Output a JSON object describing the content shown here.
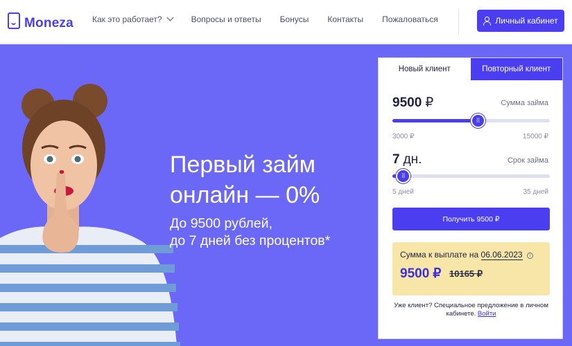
{
  "header": {
    "logo_text": "Moneza",
    "nav": [
      {
        "label": "Как это работает?"
      },
      {
        "label": "Вопросы и ответы"
      },
      {
        "label": "Бонусы"
      },
      {
        "label": "Контакты"
      },
      {
        "label": "Пожаловаться"
      }
    ],
    "cabinet_label": "Личный кабинет"
  },
  "hero": {
    "title_line1": "Первый займ",
    "title_line2": "онлайн — 0%",
    "subtitle_line1": "До 9500 рублей,",
    "subtitle_line2": "до 7 дней без процентов*"
  },
  "calculator": {
    "tabs": {
      "new_client": "Новый клиент",
      "repeat_client": "Повторный клиент"
    },
    "amount": {
      "value": "9500",
      "unit": "₽",
      "label": "Сумма займа",
      "min_label": "3000 ₽",
      "max_label": "15000 ₽",
      "min": 3000,
      "max": 15000,
      "current": 9500
    },
    "term": {
      "value": "7",
      "unit": "дн.",
      "label": "Срок займа",
      "min_label": "5 дней",
      "max_label": "35 дней",
      "min": 5,
      "max": 35,
      "current": 7
    },
    "submit_label": "Получить 9500 ₽",
    "payout": {
      "label": "Сумма к выплате на",
      "date": "06.06.2023",
      "amount": "9500",
      "unit": "₽",
      "old_amount": "10165 ₽"
    },
    "note_text": "Уже клиент? Специальное предложение в личном кабинете.",
    "note_link": "Войти"
  },
  "colors": {
    "accent": "#4a3ef0",
    "hero_bg": "#6b68f8",
    "payout_bg": "#f7e6a8"
  }
}
